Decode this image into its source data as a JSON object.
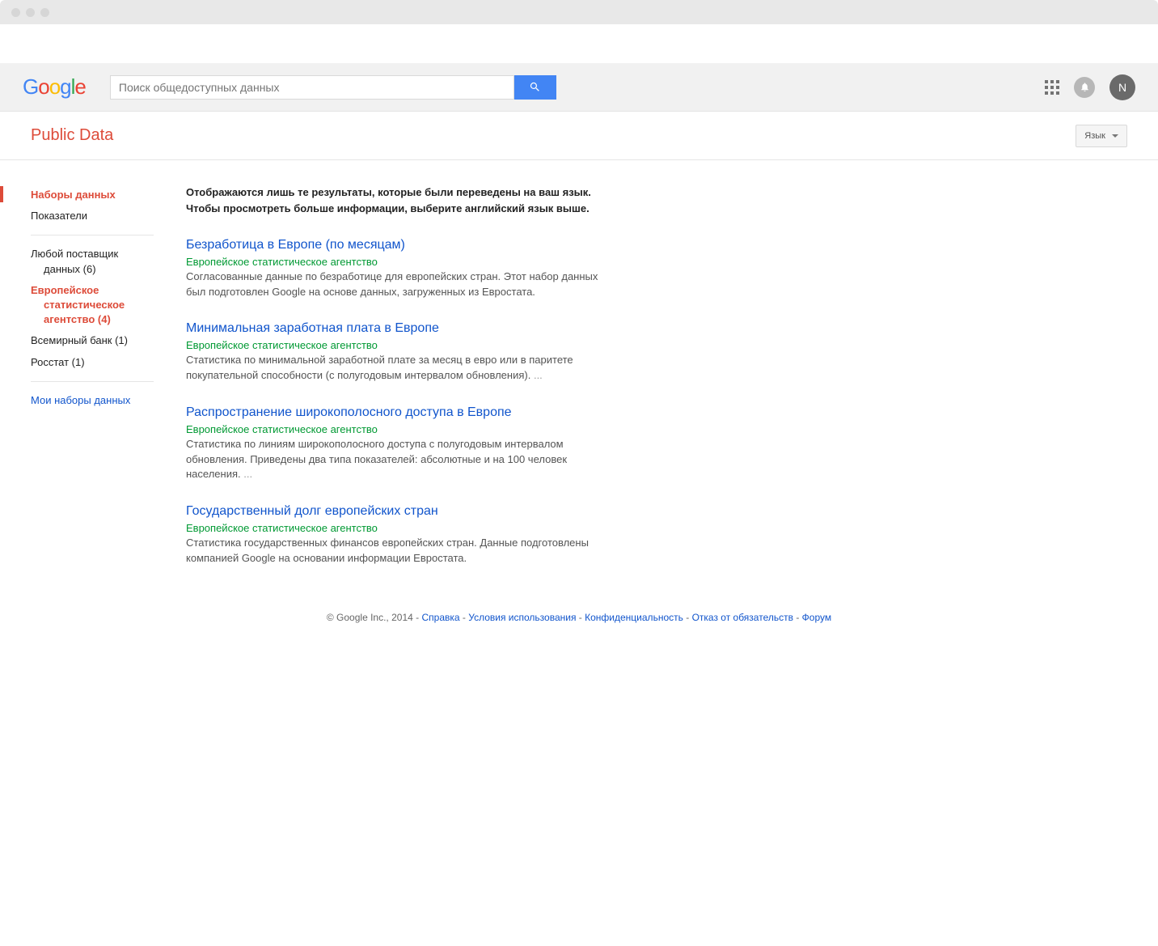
{
  "search": {
    "placeholder": "Поиск общедоступных данных"
  },
  "header": {
    "avatar_letter": "N"
  },
  "subheader": {
    "page_title": "Public Data",
    "lang_button": "Язык"
  },
  "sidebar": {
    "nav1_active": "Наборы данных",
    "nav2": "Показатели",
    "prov1_line1": "Любой поставщик",
    "prov1_line2": "данных (6)",
    "prov2_line1": "Европейское",
    "prov2_line2": "статистическое",
    "prov2_line3": "агентство (4)",
    "prov3": "Всемирный банк (1)",
    "prov4": "Росстат (1)",
    "my_datasets": "Мои наборы данных"
  },
  "notice": {
    "line1": "Отображаются лишь те результаты, которые были переведены на ваш язык.",
    "line2": "Чтобы просмотреть больше информации, выберите английский язык выше."
  },
  "results": [
    {
      "title": "Безработица в Европе (по месяцам)",
      "source": "Европейское статистическое агентство",
      "snippet": "Согласованные данные по безработице для европейских стран. Этот набор данных был подготовлен Google на основе данных, загруженных из Евростата.",
      "ellipsis": false
    },
    {
      "title": "Минимальная заработная плата в Европе",
      "source": "Европейское статистическое агентство",
      "snippet": "Статистика по минимальной заработной плате за месяц в евро или в паритете покупательной способности (с полугодовым интервалом обновления).",
      "ellipsis": true
    },
    {
      "title": "Распространение широкополосного доступа в Европе",
      "source": "Европейское статистическое агентство",
      "snippet": "Статистика по линиям широкополосного доступа с полугодовым интервалом обновления. Приведены два типа показателей: абсолютные и на 100 человек населения.",
      "ellipsis": true
    },
    {
      "title": "Государственный долг европейских стран",
      "source": "Европейское статистическое агентство",
      "snippet": "Статистика государственных финансов европейских стран. Данные подготовлены компанией Google на основании информации Евростата.",
      "ellipsis": false
    }
  ],
  "footer": {
    "copyright": "© Google Inc., 2014",
    "links": {
      "help": "Справка",
      "terms": "Условия использования",
      "privacy": "Конфиденциальность",
      "disclaimer": "Отказ от обязательств",
      "forum": "Форум"
    }
  }
}
